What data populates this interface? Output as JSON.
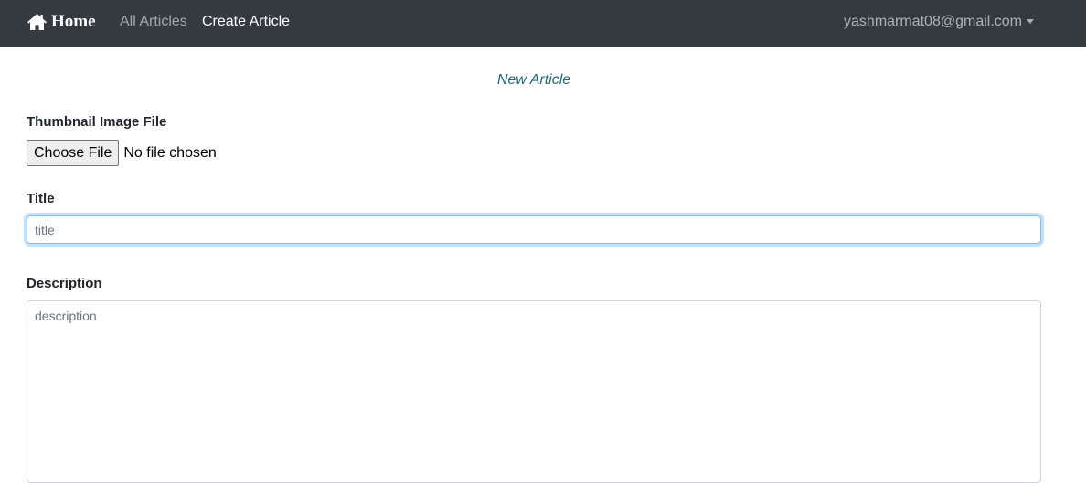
{
  "navbar": {
    "brand_icon": "home-icon",
    "brand_label": "Home",
    "links": [
      {
        "label": "All Articles",
        "active": false
      },
      {
        "label": "Create Article",
        "active": true
      }
    ],
    "user_email": "yashmarmat08@gmail.com",
    "user_menu_icon": "caret-down-icon",
    "background": "#343a40"
  },
  "page": {
    "heading": "New Article",
    "heading_color": "#1c6a74"
  },
  "form": {
    "thumbnail": {
      "label": "Thumbnail Image File",
      "button_label": "Choose File",
      "status": "No file chosen"
    },
    "title": {
      "label": "Title",
      "placeholder": "title",
      "value": "",
      "focused": true
    },
    "description": {
      "label": "Description",
      "placeholder": "description",
      "value": ""
    }
  }
}
